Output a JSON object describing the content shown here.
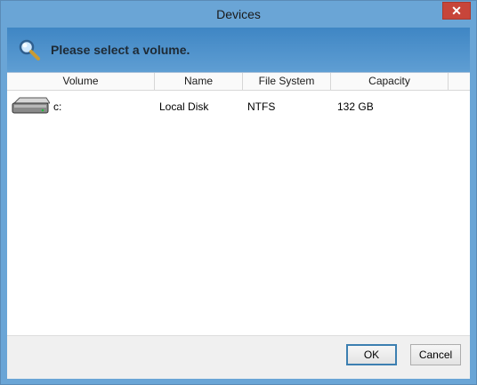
{
  "window": {
    "title": "Devices",
    "close_symbol": "✕"
  },
  "header": {
    "message": "Please select a volume.",
    "icon": "search-magnifier-icon"
  },
  "columns": [
    "Volume",
    "Name",
    "File System",
    "Capacity"
  ],
  "rows": [
    {
      "volume": "c:",
      "name": "Local Disk",
      "file_system": "NTFS",
      "capacity": "132 GB",
      "icon": "hard-drive-icon"
    }
  ],
  "buttons": {
    "ok": "OK",
    "cancel": "Cancel"
  }
}
